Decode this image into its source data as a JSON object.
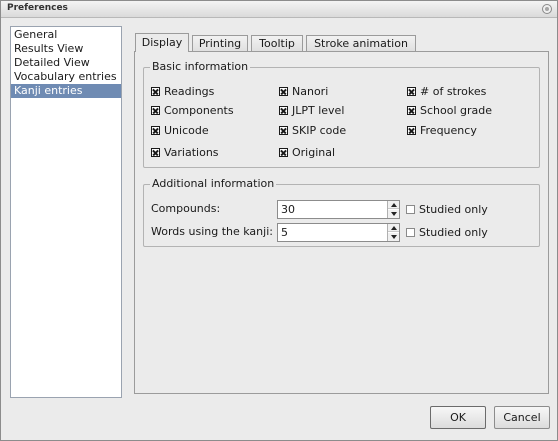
{
  "window": {
    "title": "Preferences"
  },
  "sidebar": {
    "items": [
      {
        "label": "General"
      },
      {
        "label": "Results View"
      },
      {
        "label": "Detailed View"
      },
      {
        "label": "Vocabulary entries"
      },
      {
        "label": "Kanji entries",
        "selected": true
      }
    ]
  },
  "tabs": [
    {
      "label": "Display",
      "active": true
    },
    {
      "label": "Printing"
    },
    {
      "label": "Tooltip"
    },
    {
      "label": "Stroke animation"
    }
  ],
  "basic": {
    "title": "Basic information",
    "readings": {
      "label": "Readings",
      "checked": true
    },
    "components": {
      "label": "Components",
      "checked": true
    },
    "unicode": {
      "label": "Unicode",
      "checked": true
    },
    "variations": {
      "label": "Variations",
      "checked": true
    },
    "nanori": {
      "label": "Nanori",
      "checked": true
    },
    "jlpt": {
      "label": "JLPT level",
      "checked": true
    },
    "skip": {
      "label": "SKIP code",
      "checked": true
    },
    "original": {
      "label": "Original",
      "checked": true
    },
    "strokes": {
      "label": "# of strokes",
      "checked": true
    },
    "school": {
      "label": "School grade",
      "checked": true
    },
    "frequency": {
      "label": "Frequency",
      "checked": true
    }
  },
  "additional": {
    "title": "Additional information",
    "compounds": {
      "label": "Compounds:",
      "value": "30",
      "studied_label": "Studied only",
      "studied_checked": false
    },
    "words": {
      "label": "Words using the kanji:",
      "value": "5",
      "studied_label": "Studied only",
      "studied_checked": false
    }
  },
  "buttons": {
    "ok": "OK",
    "cancel": "Cancel"
  },
  "colors": {
    "selection": "#6f8bb3",
    "background": "#ebebeb"
  },
  "icons": {
    "close": "close-icon",
    "checkbox_checked": "x-mark"
  }
}
